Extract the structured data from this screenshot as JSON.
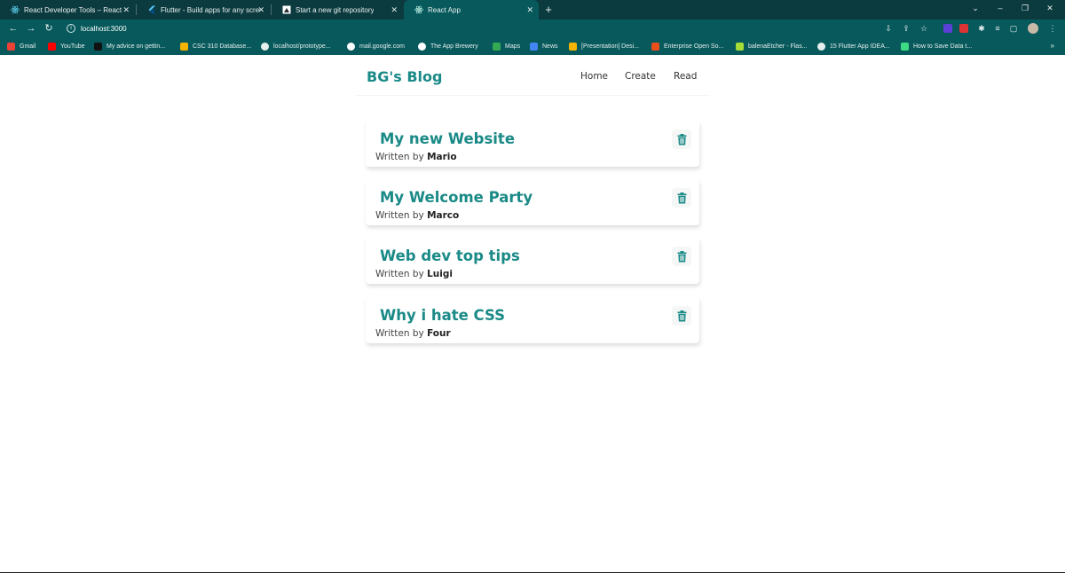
{
  "browser": {
    "tabs": [
      {
        "title": "React Developer Tools – React",
        "icon": "react-icon",
        "active": false
      },
      {
        "title": "Flutter - Build apps for any scree",
        "icon": "flutter-icon",
        "active": false
      },
      {
        "title": "Start a new git repository",
        "icon": "github-icon",
        "active": false
      },
      {
        "title": "React App",
        "icon": "react-icon",
        "active": true
      }
    ],
    "url": "localhost:3000",
    "bookmarks": [
      {
        "label": "Gmail",
        "icon": "gmail-icon",
        "color": "#ea4335"
      },
      {
        "label": "YouTube",
        "icon": "youtube-icon",
        "color": "#ff0000"
      },
      {
        "label": "My advice on gettin...",
        "icon": "medium-icon",
        "color": "#111111"
      },
      {
        "label": "CSC 310 Database...",
        "icon": "slides-icon",
        "color": "#f4b400"
      },
      {
        "label": "localhost/prototype...",
        "icon": "globe-icon",
        "color": "#e6eeee"
      },
      {
        "label": "mail.google.com",
        "icon": "google-icon",
        "color": "#ffffff"
      },
      {
        "label": "The App Brewery",
        "icon": "brewery-icon",
        "color": "#ffffff"
      },
      {
        "label": "Maps",
        "icon": "maps-icon",
        "color": "#34a853"
      },
      {
        "label": "News",
        "icon": "news-icon",
        "color": "#4285f4"
      },
      {
        "label": "[Presentation] Desi...",
        "icon": "slides-icon",
        "color": "#f4b400"
      },
      {
        "label": "Enterprise Open So...",
        "icon": "redhat-icon",
        "color": "#e94e1b"
      },
      {
        "label": "balenaEtcher - Flas...",
        "icon": "balena-icon",
        "color": "#a5de37"
      },
      {
        "label": "15 Flutter App IDEA...",
        "icon": "globe-icon",
        "color": "#e6eeee"
      },
      {
        "label": "How to Save Data t...",
        "icon": "link-icon",
        "color": "#3ddc84"
      }
    ],
    "bookmarks_more": "»"
  },
  "app": {
    "brand": "BG's Blog",
    "nav": [
      "Home",
      "Create",
      "Read"
    ],
    "blogs": [
      {
        "title": "My new Website",
        "byline_prefix": "Written by",
        "author": "Mario"
      },
      {
        "title": "My Welcome Party",
        "byline_prefix": "Written by",
        "author": "Marco"
      },
      {
        "title": "Web dev top tips",
        "byline_prefix": "Written by",
        "author": "Luigi"
      },
      {
        "title": "Why i hate CSS",
        "byline_prefix": "Written by",
        "author": "Four"
      }
    ],
    "colors": {
      "accent": "#1a8a87",
      "chrome_dark": "#0c3b3f",
      "chrome": "#07595c"
    }
  }
}
